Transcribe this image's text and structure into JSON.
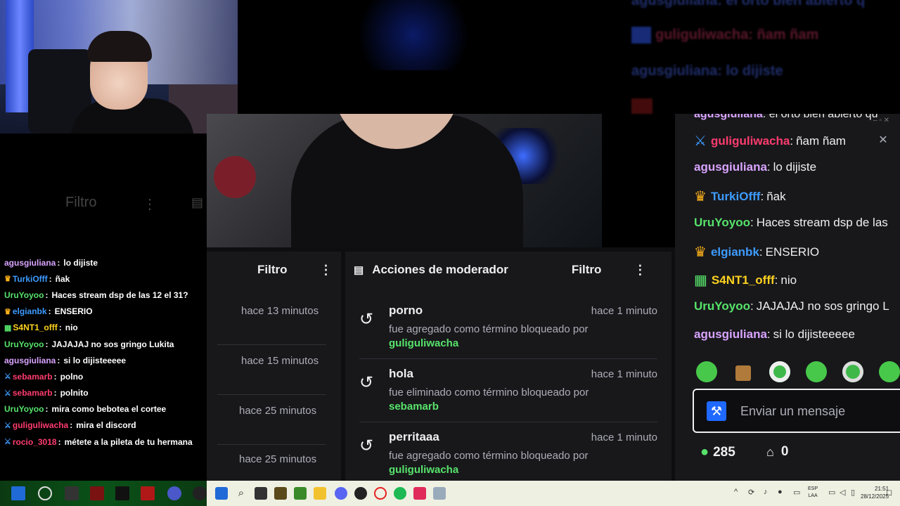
{
  "left_chat": {
    "filter_label": "Filtro",
    "messages": [
      {
        "user": "agusgiuliana",
        "color": "#d9a4ff",
        "badges": "",
        "text": "lo dijiste"
      },
      {
        "user": "TurkiOfff",
        "color": "#3d9bff",
        "badges": "crown",
        "text": "ñak"
      },
      {
        "user": "UruYoyoo",
        "color": "#57e36b",
        "badges": "",
        "text": "Haces stream dsp de las 12 el 31?"
      },
      {
        "user": "elgianbk",
        "color": "#3d9bff",
        "badges": "crown",
        "text": "ENSERIO"
      },
      {
        "user": "S4NT1_offf",
        "color": "#ffd21f",
        "badges": "88",
        "text": "nio"
      },
      {
        "user": "UruYoyoo",
        "color": "#57e36b",
        "badges": "",
        "text": "JAJAJAJ no sos gringo Lukita"
      },
      {
        "user": "agusgiuliana",
        "color": "#d9a4ff",
        "badges": "",
        "text": "si lo dijisteeeee"
      },
      {
        "user": "sebamarb",
        "color": "#ff3c6e",
        "badges": "sword",
        "text": "polno"
      },
      {
        "user": "sebamarb",
        "color": "#ff3c6e",
        "badges": "sword",
        "text": "polnito"
      },
      {
        "user": "UruYoyoo",
        "color": "#57e36b",
        "badges": "",
        "text": "mira como bebotea el cortee"
      },
      {
        "user": "guliguliwacha",
        "color": "#ff3c6e",
        "badges": "sword",
        "text": "mira el discord"
      },
      {
        "user": "rocio_3018",
        "color": "#ff3c6e",
        "badges": "sword",
        "text": "métete a la pileta de tu hermana"
      }
    ]
  },
  "ghost_chat": [
    {
      "text": "agusgiuliana: el orto bien abierto q"
    },
    {
      "text": "guliguliwacha: ñam ñam"
    },
    {
      "text": "agusgiuliana: lo dijiste"
    }
  ],
  "panel_a": {
    "filter_label": "Filtro",
    "times": [
      "hace 13 minutos",
      "hace 15 minutos",
      "hace 25 minutos",
      "hace 25 minutos"
    ]
  },
  "mod_actions": {
    "title": "Acciones de moderador",
    "filter_label": "Filtro",
    "items": [
      {
        "term": "porno",
        "time": "hace 1 minuto",
        "desc": "fue agregado como término bloqueado por",
        "by": "guliguliwacha"
      },
      {
        "term": "hola",
        "time": "hace 1 minuto",
        "desc": "fue eliminado como término bloqueado por",
        "by": "sebamarb"
      },
      {
        "term": "perritaaa",
        "time": "hace 1 minuto",
        "desc": "fue agregado como término bloqueado por",
        "by": "guliguliwacha"
      }
    ]
  },
  "right_chat": {
    "top_partial": {
      "user": "agusgiuliana",
      "text": ": el orto bien abierto qu"
    },
    "messages": [
      {
        "user": "guliguliwacha",
        "color": "#ff3c6e",
        "badge": "sword",
        "text": "ñam ñam"
      },
      {
        "user": "agusgiuliana",
        "color": "#d9a4ff",
        "badge": "",
        "text": "lo dijiste"
      },
      {
        "user": "TurkiOfff",
        "color": "#3d9bff",
        "badge": "crown",
        "text": "ñak"
      },
      {
        "user": "UruYoyoo",
        "color": "#57e36b",
        "badge": "",
        "text": "Haces stream dsp de las"
      },
      {
        "user": "elgianbk",
        "color": "#3d9bff",
        "badge": "crown",
        "text": "ENSERIO"
      },
      {
        "user": "S4NT1_offf",
        "color": "#ffd21f",
        "badge": "88",
        "text": "nio"
      },
      {
        "user": "UruYoyoo",
        "color": "#57e36b",
        "badge": "",
        "text": "JAJAJAJ no sos gringo L"
      },
      {
        "user": "agusgiuliana",
        "color": "#d9a4ff",
        "badge": "",
        "text": "si lo dijisteeeee"
      }
    ],
    "input_placeholder": "Enviar un mensaje",
    "points": "285",
    "store_count": "0"
  },
  "taskbar": {
    "lang_top": "ESP",
    "lang_bottom": "LAA",
    "time": "21:51",
    "date": "28/12/2025"
  },
  "colors": {
    "accent": "#1f69ff",
    "green": "#57e36b",
    "red": "#ff3c6e",
    "panel": "#18181b"
  }
}
